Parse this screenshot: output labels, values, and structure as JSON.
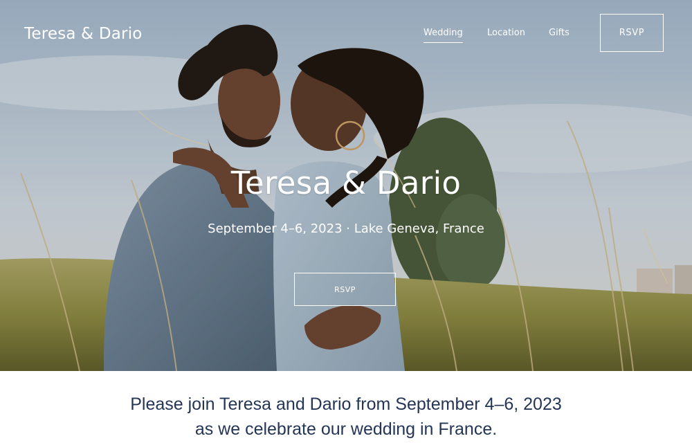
{
  "site": {
    "brand": "Teresa & Dario"
  },
  "nav": {
    "items": [
      {
        "label": "Wedding",
        "active": true
      },
      {
        "label": "Location",
        "active": false
      },
      {
        "label": "Gifts",
        "active": false
      }
    ],
    "rsvp_label": "RSVP"
  },
  "hero": {
    "title": "Teresa & Dario",
    "subtitle": "September 4–6, 2023 · Lake Geneva, France",
    "rsvp_label": "RSVP",
    "image_alt": "Couple embracing in a tall-grass field at sunset"
  },
  "invite": {
    "line1": "Please join Teresa and Dario from September 4–6, 2023",
    "line2": "as we celebrate our wedding in France."
  },
  "colors": {
    "text_on_hero": "#ffffff",
    "invite_text": "#243556",
    "page_background": "#ffffff"
  }
}
